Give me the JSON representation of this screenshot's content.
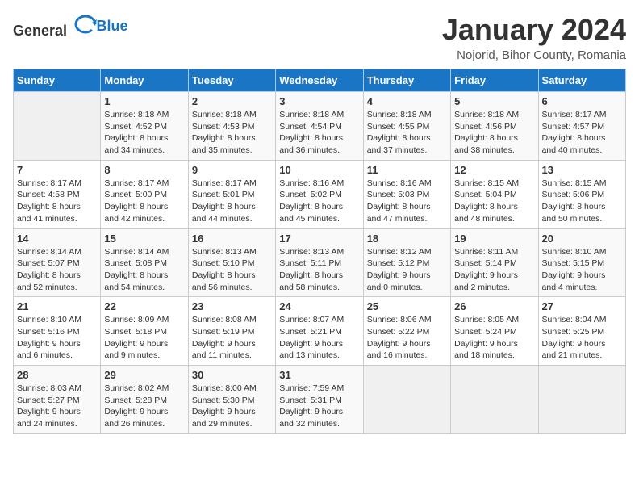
{
  "header": {
    "logo_general": "General",
    "logo_blue": "Blue",
    "month": "January 2024",
    "location": "Nojorid, Bihor County, Romania"
  },
  "weekdays": [
    "Sunday",
    "Monday",
    "Tuesday",
    "Wednesday",
    "Thursday",
    "Friday",
    "Saturday"
  ],
  "weeks": [
    [
      {
        "day": "",
        "info": ""
      },
      {
        "day": "1",
        "info": "Sunrise: 8:18 AM\nSunset: 4:52 PM\nDaylight: 8 hours\nand 34 minutes."
      },
      {
        "day": "2",
        "info": "Sunrise: 8:18 AM\nSunset: 4:53 PM\nDaylight: 8 hours\nand 35 minutes."
      },
      {
        "day": "3",
        "info": "Sunrise: 8:18 AM\nSunset: 4:54 PM\nDaylight: 8 hours\nand 36 minutes."
      },
      {
        "day": "4",
        "info": "Sunrise: 8:18 AM\nSunset: 4:55 PM\nDaylight: 8 hours\nand 37 minutes."
      },
      {
        "day": "5",
        "info": "Sunrise: 8:18 AM\nSunset: 4:56 PM\nDaylight: 8 hours\nand 38 minutes."
      },
      {
        "day": "6",
        "info": "Sunrise: 8:17 AM\nSunset: 4:57 PM\nDaylight: 8 hours\nand 40 minutes."
      }
    ],
    [
      {
        "day": "7",
        "info": "Sunrise: 8:17 AM\nSunset: 4:58 PM\nDaylight: 8 hours\nand 41 minutes."
      },
      {
        "day": "8",
        "info": "Sunrise: 8:17 AM\nSunset: 5:00 PM\nDaylight: 8 hours\nand 42 minutes."
      },
      {
        "day": "9",
        "info": "Sunrise: 8:17 AM\nSunset: 5:01 PM\nDaylight: 8 hours\nand 44 minutes."
      },
      {
        "day": "10",
        "info": "Sunrise: 8:16 AM\nSunset: 5:02 PM\nDaylight: 8 hours\nand 45 minutes."
      },
      {
        "day": "11",
        "info": "Sunrise: 8:16 AM\nSunset: 5:03 PM\nDaylight: 8 hours\nand 47 minutes."
      },
      {
        "day": "12",
        "info": "Sunrise: 8:15 AM\nSunset: 5:04 PM\nDaylight: 8 hours\nand 48 minutes."
      },
      {
        "day": "13",
        "info": "Sunrise: 8:15 AM\nSunset: 5:06 PM\nDaylight: 8 hours\nand 50 minutes."
      }
    ],
    [
      {
        "day": "14",
        "info": "Sunrise: 8:14 AM\nSunset: 5:07 PM\nDaylight: 8 hours\nand 52 minutes."
      },
      {
        "day": "15",
        "info": "Sunrise: 8:14 AM\nSunset: 5:08 PM\nDaylight: 8 hours\nand 54 minutes."
      },
      {
        "day": "16",
        "info": "Sunrise: 8:13 AM\nSunset: 5:10 PM\nDaylight: 8 hours\nand 56 minutes."
      },
      {
        "day": "17",
        "info": "Sunrise: 8:13 AM\nSunset: 5:11 PM\nDaylight: 8 hours\nand 58 minutes."
      },
      {
        "day": "18",
        "info": "Sunrise: 8:12 AM\nSunset: 5:12 PM\nDaylight: 9 hours\nand 0 minutes."
      },
      {
        "day": "19",
        "info": "Sunrise: 8:11 AM\nSunset: 5:14 PM\nDaylight: 9 hours\nand 2 minutes."
      },
      {
        "day": "20",
        "info": "Sunrise: 8:10 AM\nSunset: 5:15 PM\nDaylight: 9 hours\nand 4 minutes."
      }
    ],
    [
      {
        "day": "21",
        "info": "Sunrise: 8:10 AM\nSunset: 5:16 PM\nDaylight: 9 hours\nand 6 minutes."
      },
      {
        "day": "22",
        "info": "Sunrise: 8:09 AM\nSunset: 5:18 PM\nDaylight: 9 hours\nand 9 minutes."
      },
      {
        "day": "23",
        "info": "Sunrise: 8:08 AM\nSunset: 5:19 PM\nDaylight: 9 hours\nand 11 minutes."
      },
      {
        "day": "24",
        "info": "Sunrise: 8:07 AM\nSunset: 5:21 PM\nDaylight: 9 hours\nand 13 minutes."
      },
      {
        "day": "25",
        "info": "Sunrise: 8:06 AM\nSunset: 5:22 PM\nDaylight: 9 hours\nand 16 minutes."
      },
      {
        "day": "26",
        "info": "Sunrise: 8:05 AM\nSunset: 5:24 PM\nDaylight: 9 hours\nand 18 minutes."
      },
      {
        "day": "27",
        "info": "Sunrise: 8:04 AM\nSunset: 5:25 PM\nDaylight: 9 hours\nand 21 minutes."
      }
    ],
    [
      {
        "day": "28",
        "info": "Sunrise: 8:03 AM\nSunset: 5:27 PM\nDaylight: 9 hours\nand 24 minutes."
      },
      {
        "day": "29",
        "info": "Sunrise: 8:02 AM\nSunset: 5:28 PM\nDaylight: 9 hours\nand 26 minutes."
      },
      {
        "day": "30",
        "info": "Sunrise: 8:00 AM\nSunset: 5:30 PM\nDaylight: 9 hours\nand 29 minutes."
      },
      {
        "day": "31",
        "info": "Sunrise: 7:59 AM\nSunset: 5:31 PM\nDaylight: 9 hours\nand 32 minutes."
      },
      {
        "day": "",
        "info": ""
      },
      {
        "day": "",
        "info": ""
      },
      {
        "day": "",
        "info": ""
      }
    ]
  ]
}
